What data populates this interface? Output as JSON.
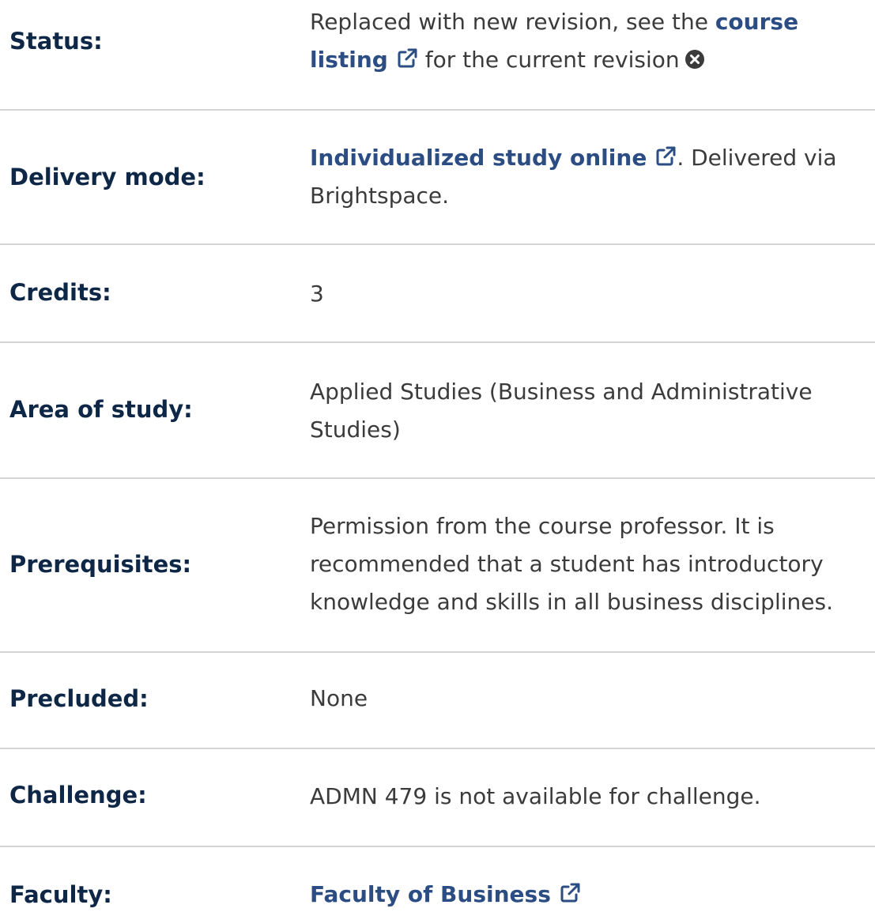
{
  "status": {
    "label": "Status:",
    "text_before": "Replaced with new revision, see the ",
    "link_part1": "course",
    "link_part2": "listing",
    "text_after": " for the current revision"
  },
  "delivery": {
    "label": "Delivery mode:",
    "link": "Individualized study online",
    "text_line1": ". Delivered via",
    "text_line2": "Brightspace."
  },
  "credits": {
    "label": "Credits:",
    "value": "3"
  },
  "area": {
    "label": "Area of study:",
    "line1": "Applied Studies (Business and Administrative",
    "line2": "Studies)"
  },
  "prerequisites": {
    "label": "Prerequisites:",
    "line1": "Permission from the course professor. It is",
    "line2": "recommended that a student has introductory",
    "line3": "knowledge and skills in all business disciplines."
  },
  "precluded": {
    "label": "Precluded:",
    "value": "None"
  },
  "challenge": {
    "label": "Challenge:",
    "value": "ADMN 479 is not available for challenge."
  },
  "faculty": {
    "label": "Faculty:",
    "link": "Faculty of Business"
  },
  "colors": {
    "label": "#0e2747",
    "link": "#2b4d83",
    "text": "#3b3b3b",
    "divider": "#d5d5d5"
  },
  "icons": [
    "external-link-icon",
    "close-circle-icon"
  ]
}
